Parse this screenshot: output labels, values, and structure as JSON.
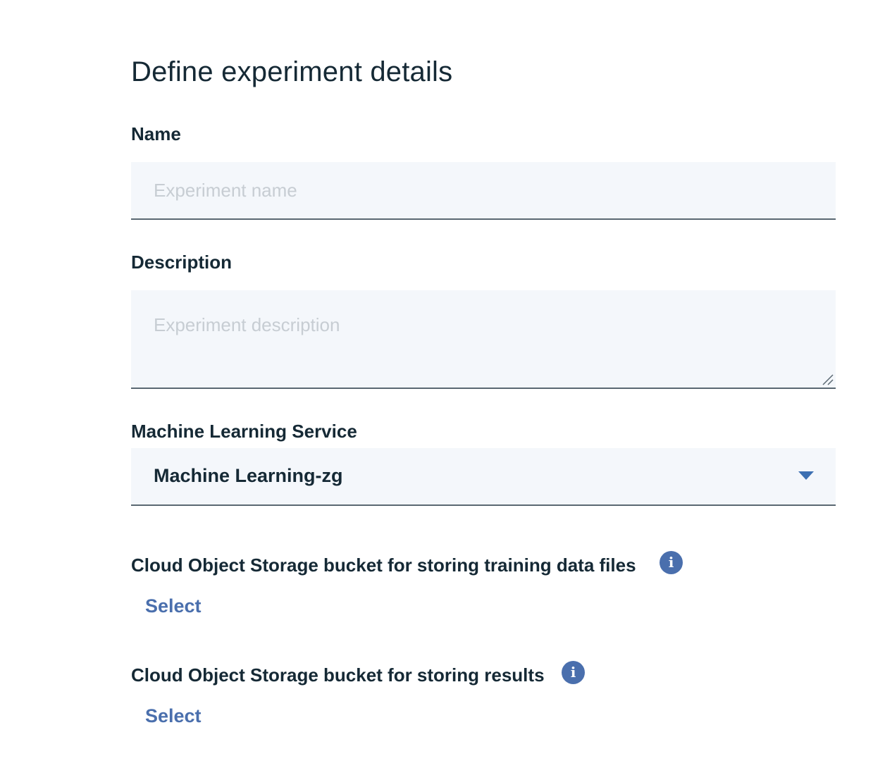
{
  "page": {
    "title": "Define experiment details"
  },
  "name_field": {
    "label": "Name",
    "placeholder": "Experiment name",
    "value": ""
  },
  "description_field": {
    "label": "Description",
    "placeholder": "Experiment description",
    "value": ""
  },
  "ml_service": {
    "label": "Machine Learning Service",
    "selected": "Machine Learning-zg"
  },
  "training_bucket": {
    "label": "Cloud Object Storage bucket for storing training data files",
    "info_icon_glyph": "i",
    "select_label": "Select"
  },
  "results_bucket": {
    "label": "Cloud Object Storage bucket for storing results",
    "info_icon_glyph": "i",
    "select_label": "Select"
  },
  "icons": {
    "info": "info-icon",
    "dropdown": "chevron-down-icon",
    "resize": "resize-handle-icon"
  },
  "colors": {
    "text": "#152935",
    "field_bg": "#f4f7fb",
    "field_border": "#5a6872",
    "placeholder": "#c7cdd3",
    "link": "#4a6fad",
    "caret": "#3d70b2"
  }
}
